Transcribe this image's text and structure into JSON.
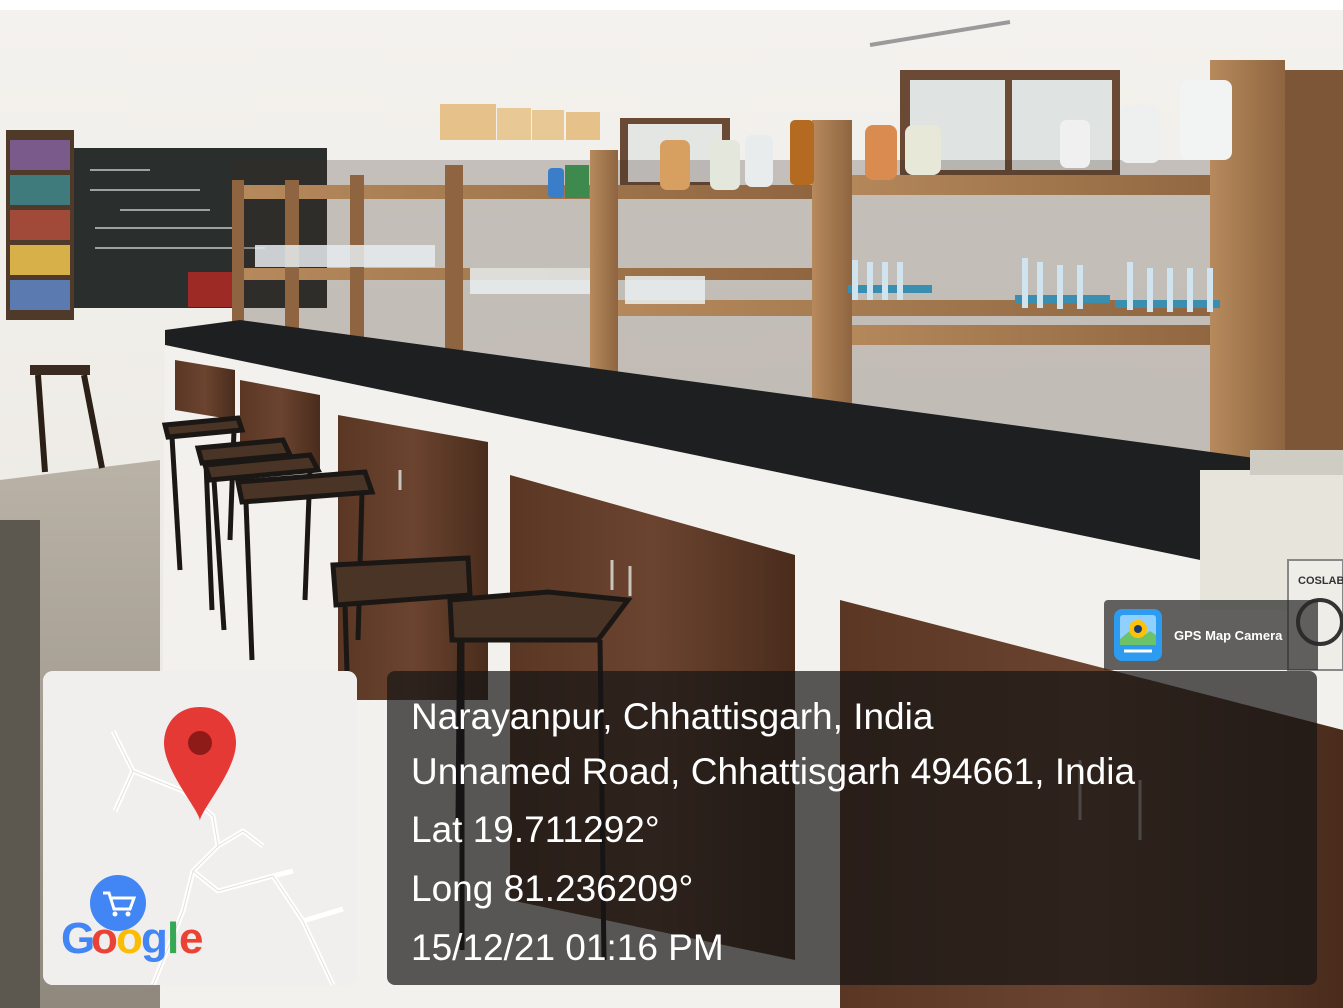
{
  "photo": {
    "description_hidden": false
  },
  "watermark": {
    "app_name": "GPS Map Camera",
    "app_icon": "gps-map-camera-icon"
  },
  "map_thumbnail": {
    "brand": "Google",
    "pin_icon": "map-pin-icon",
    "cart_icon": "shopping-cart-icon",
    "pin_color": "#e53935"
  },
  "location": {
    "place": "Narayanpur, Chhattisgarh, India",
    "address": "Unnamed Road, Chhattisgarh 494661, India",
    "lat": "Lat 19.711292°",
    "long": "Long 81.236209°",
    "timestamp": "15/12/21 01:16 PM"
  },
  "background_scene": {
    "bench_label": "COSLAB"
  }
}
